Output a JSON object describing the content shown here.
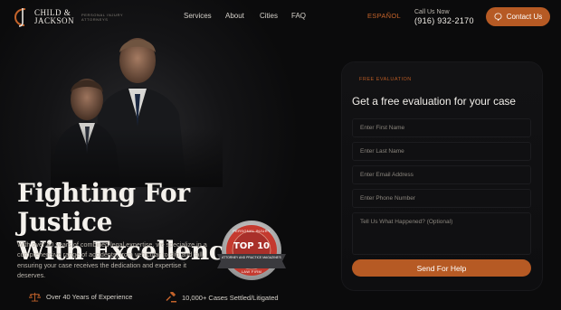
{
  "header": {
    "logo": {
      "line1": "CHILD &",
      "line2": "JACKSON",
      "tagline": "PERSONAL INJURY ATTORNEYS"
    },
    "nav": [
      {
        "label": "Services"
      },
      {
        "label": "About"
      },
      {
        "label": "Cities"
      },
      {
        "label": "FAQ"
      }
    ],
    "language_label": "ESPAÑOL",
    "call_label": "Call Us Now",
    "call_number": "(916) 932-2170",
    "contact_label": "Contact Us"
  },
  "hero": {
    "headline_line1": "Fighting For Justice",
    "headline_line2": "With Excellence",
    "intro": "With over 40 years of combined legal expertise, we specialize in a comprehensive range of accidents, from vehicular to slip and fall, ensuring your case receives the dedication and expertise it deserves.",
    "badge": {
      "top_text": "PERSONAL INJURY",
      "big_text": "TOP 10",
      "ribbon_text": "ATTORNEY AND PRACTICE MAGAZINE'S",
      "bottom_text": "LAW FIRM"
    },
    "stats": [
      {
        "icon": "scales-icon",
        "label": "Over 40 Years of Experience"
      },
      {
        "icon": "gavel-icon",
        "label": "10,000+ Cases Settled/Litigated"
      }
    ]
  },
  "form": {
    "kicker": "FREE EVALUATION",
    "title": "Get a free evaluation for your case",
    "first_name_placeholder": "Enter First Name",
    "last_name_placeholder": "Enter Last Name",
    "email_placeholder": "Enter Email Address",
    "phone_placeholder": "Enter Phone Number",
    "message_placeholder": "Tell Us What Happened? (Optional)",
    "submit_label": "Send For Help"
  },
  "colors": {
    "accent": "#b65a24",
    "background": "#0b0b0c",
    "card": "#121214"
  }
}
